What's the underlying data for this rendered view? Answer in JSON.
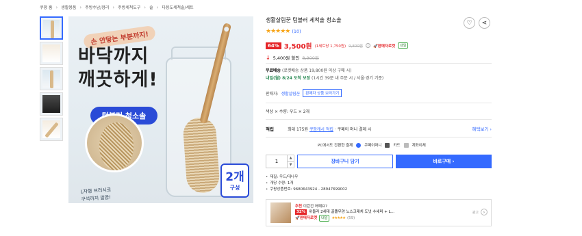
{
  "breadcrumb": [
    "쿠팡 홈",
    "생활용품",
    "주방수납/정리",
    "주방세척도구",
    "솔",
    "다용도세척솔/세트"
  ],
  "image": {
    "promo_badge": "손 안닿는 부분까지!",
    "headline_line1": "바닥까지",
    "headline_line2": "깨끗하게!",
    "cta": "텀블러 청소솔",
    "note_line1": "L자형 브러시로",
    "note_line2": "구석까지 깔끔!",
    "count_big": "2개",
    "count_small": "구성"
  },
  "product": {
    "title": "생활살림꾼 텀블러 세척솔 청소솔",
    "stars": "★★★★★",
    "review_count": "(10)",
    "discount": "64%",
    "price": "3,500원",
    "unit_price": "(1세트당 1,750원)",
    "orig_price": "9,800원",
    "lowest_badge": "🚀판매자로켓",
    "tomorrow_badge": "내일",
    "sale_amount": "5,400원 할인",
    "sale_orig": "8,900원"
  },
  "shipping": {
    "free_label": "무료배송",
    "free_cond": "(로켓배송 상품 19,800원 이상 구매 시)",
    "arrive": "내일(월) 8/24 도착 보장",
    "arrive_cond": "(1시간 39분 내 주문 시 / 서울⋅경기 기준)"
  },
  "seller": {
    "label": "판매자:",
    "name": "생활살림꾼",
    "button": "판매자 상품 보러가기"
  },
  "option": "색상 × 수량: 우드 × 2개",
  "points": {
    "label": "적립",
    "prefix": "최대 175원",
    "highlight": "쿠팡캐시 적립",
    "suffix": "· 쿠페이 머니 결제 시",
    "benefit": "혜택보기 ›"
  },
  "payment": {
    "label": "PC에서도 간편한 결제",
    "coupay": "쿠페이머니",
    "card": "카드",
    "account": "계좌이체"
  },
  "actions": {
    "quantity": "1",
    "cart": "장바구니 담기",
    "buy": "바로구매 ›"
  },
  "specs": [
    "재질: 우드/대나무",
    "개당 수량: 1개",
    "쿠팡상품번호: 9680643924 - 28947699002"
  ],
  "recommend": {
    "tag": "추천",
    "question": "이런건 어때요?",
    "pct": "32%",
    "name": "위들러 2세대 골똘우양 노스크래치 도넛 수세미 + L...",
    "rocket": "🚀판매자로켓",
    "tomorrow": "내일",
    "stars": "★★★★★",
    "count": "(59)",
    "ad": "광고"
  }
}
